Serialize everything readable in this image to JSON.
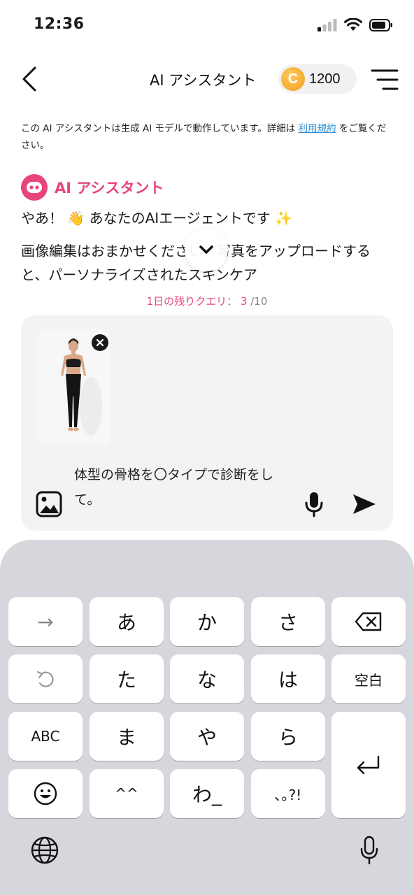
{
  "status_bar": {
    "time": "12:36"
  },
  "header": {
    "title": "AI アシスタント",
    "coin_symbol": "C",
    "coin_count": "1200"
  },
  "disclaimer": {
    "text": "この AI アシスタントは生成 AI モデルで動作しています。詳細は ",
    "link": "利用規約",
    "suffix": " をご覧ください。"
  },
  "assistant": {
    "name": "AI アシスタント",
    "greeting": "やあ！ 👋 あなたのAIエージェントです ✨",
    "body": "画像編集はおまかせください。写真をアップロードすると、パーソナライズされたスキンケア"
  },
  "query_limit": {
    "label": "1日の残りクエリ：",
    "remaining": "3",
    "total": "/10"
  },
  "composer": {
    "text": "体型の骨格を〇タイプで診断をして。"
  },
  "keyboard": {
    "row1": [
      "→",
      "あ",
      "か",
      "さ"
    ],
    "row2": [
      "た",
      "な",
      "は",
      "空白"
    ],
    "row3": [
      "ABC",
      "ま",
      "や",
      "ら"
    ],
    "row4": [
      "^^",
      "わ_",
      "､｡?!"
    ]
  },
  "colors": {
    "accent": "#e8457b",
    "link": "#2a8fd6",
    "coin": "#f0a020",
    "keyboard_bg": "#d5d7dd"
  }
}
